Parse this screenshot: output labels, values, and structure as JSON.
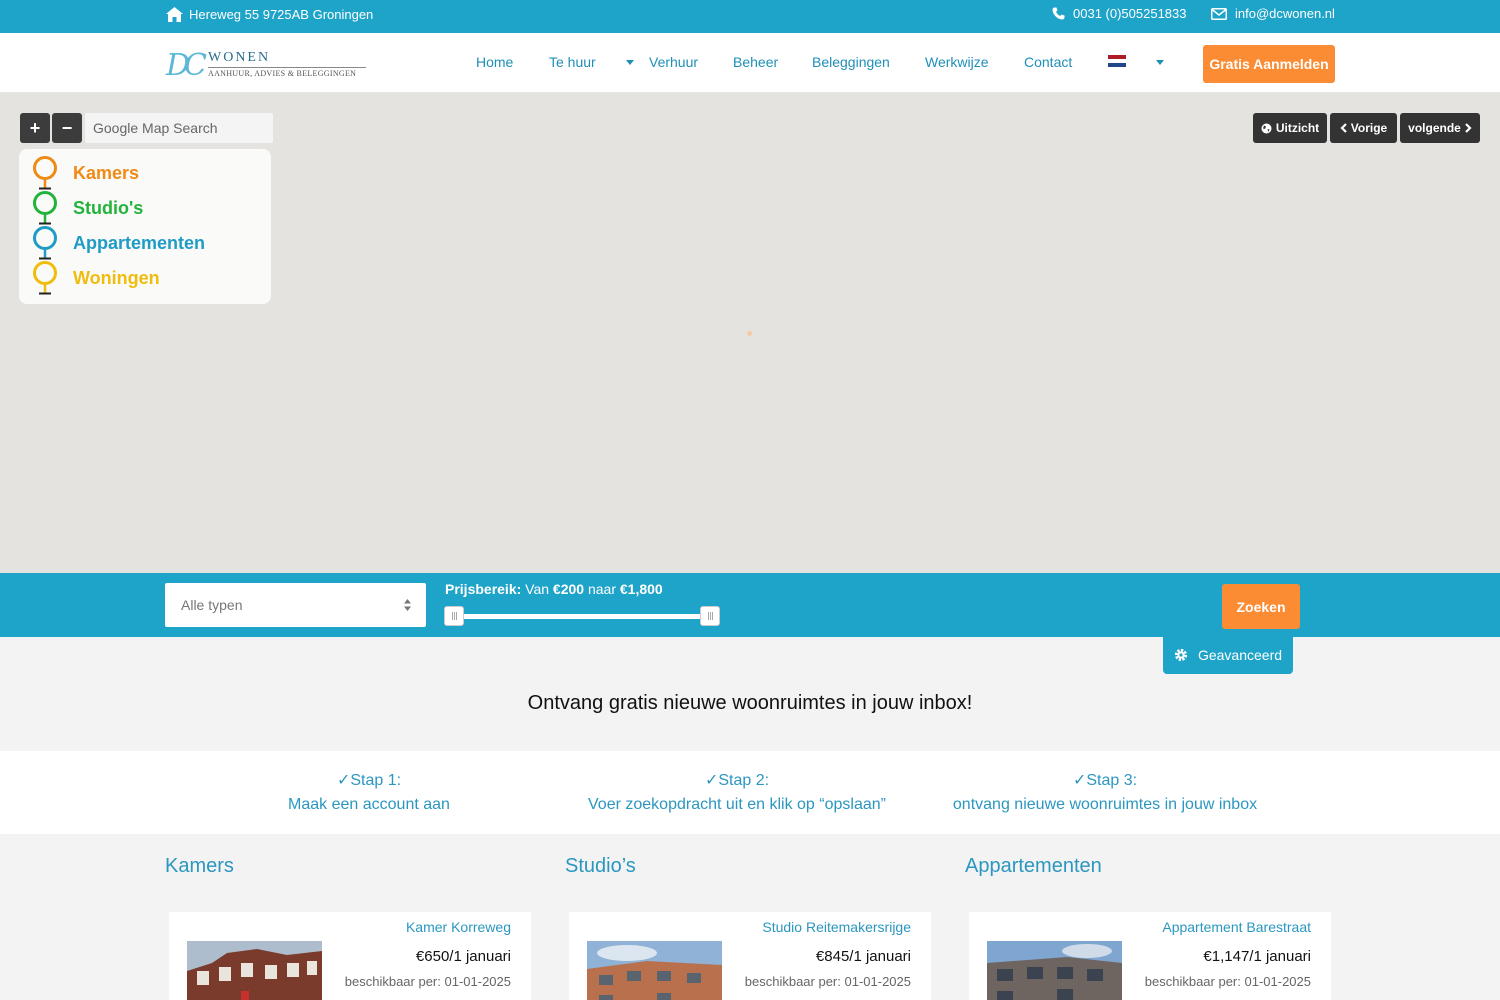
{
  "topbar": {
    "address": "Hereweg 55 9725AB Groningen",
    "phone": "0031 (0)505251833",
    "email": "info@dcwonen.nl"
  },
  "logo": {
    "mark": "DC",
    "name": "WONEN",
    "tagline": "AANHUUR, ADVIES & BELEGGINGEN"
  },
  "nav": {
    "items": [
      "Home",
      "Te huur",
      "Verhuur",
      "Beheer",
      "Beleggingen",
      "Werkwijze",
      "Contact"
    ],
    "signup_label": "Gratis Aanmelden",
    "flag_colors": [
      "#ae1c28",
      "#ffffff",
      "#21468b"
    ]
  },
  "map": {
    "search_placeholder": "Google Map Search",
    "zoom_in": "+",
    "zoom_out": "−",
    "controls": {
      "view": "Uitzicht",
      "prev": "Vorige",
      "next": "volgende"
    },
    "legend": [
      {
        "label": "Kamers",
        "color": "#ef8a17"
      },
      {
        "label": "Studio's",
        "color": "#23b33c"
      },
      {
        "label": "Appartementen",
        "color": "#1f9cc6"
      },
      {
        "label": "Woningen",
        "color": "#f0bd0e"
      }
    ]
  },
  "search": {
    "type_select": "Alle typen",
    "price_label": "Prijsbereik:",
    "from_word": "Van",
    "min": "€200",
    "to_word": "naar",
    "max": "€1,800",
    "submit": "Zoeken",
    "advanced": "Geavanceerd"
  },
  "headline": "Ontvang gratis nieuwe woonruimtes in jouw inbox!",
  "steps": [
    {
      "title": "✓Stap 1:",
      "text": "Maak een account aan"
    },
    {
      "title": "✓Stap 2:",
      "text": "Voer zoekopdracht uit en klik op “opslaan”"
    },
    {
      "title": "✓Stap 3:",
      "text": "ontvang nieuwe woonruimtes in jouw inbox"
    }
  ],
  "categories": [
    {
      "heading": "Kamers",
      "title": "Kamer Korreweg",
      "price": "€650/1 januari",
      "available": "beschikbaar per: 01-01-2025"
    },
    {
      "heading": "Studio’s",
      "title": "Studio Reitemakersrijge",
      "price": "€845/1 januari",
      "available": "beschikbaar per: 01-01-2025"
    },
    {
      "heading": "Appartementen",
      "title": "Appartement Barestraat",
      "price": "€1,147/1 januari",
      "available": "beschikbaar per: 01-01-2025"
    }
  ]
}
